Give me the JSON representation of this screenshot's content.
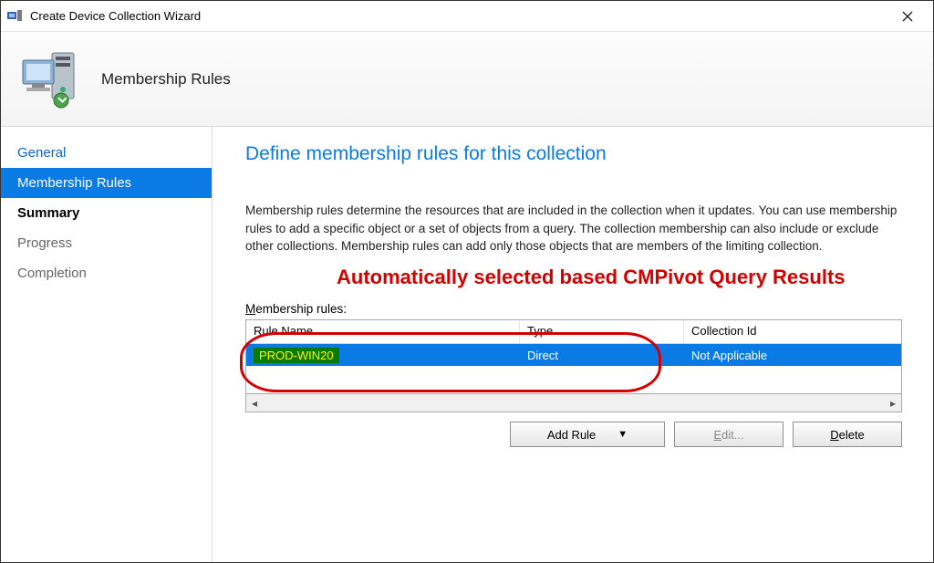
{
  "window": {
    "title": "Create Device Collection Wizard"
  },
  "banner": {
    "title": "Membership Rules"
  },
  "sidebar": {
    "steps": [
      {
        "label": "General",
        "active": false,
        "link": true
      },
      {
        "label": "Membership Rules",
        "active": true,
        "link": true
      },
      {
        "label": "Summary",
        "active": false,
        "link": true
      },
      {
        "label": "Progress",
        "active": false,
        "link": false
      },
      {
        "label": "Completion",
        "active": false,
        "link": false
      }
    ]
  },
  "main": {
    "heading": "Define membership rules for this collection",
    "description": "Membership rules determine the resources that are included in the collection when it updates. You can use membership rules to add a specific object or a set of objects from a query. The collection membership can also include or exclude other collections. Membership rules can add only those objects that are members of the limiting collection.",
    "annotation": "Automatically selected based CMPivot Query Results",
    "rules_label_prefix": "M",
    "rules_label_rest": "embership rules:",
    "columns": {
      "c1": "Rule Name",
      "c2": "Type",
      "c3": "Collection Id"
    },
    "rows": [
      {
        "name": "PROD-WIN20",
        "type": "Direct",
        "collection_id": "Not Applicable"
      }
    ],
    "buttons": {
      "add": "Add Rule",
      "edit_prefix": "E",
      "edit_rest": "dit...",
      "delete_prefix": "D",
      "delete_rest": "elete"
    }
  }
}
